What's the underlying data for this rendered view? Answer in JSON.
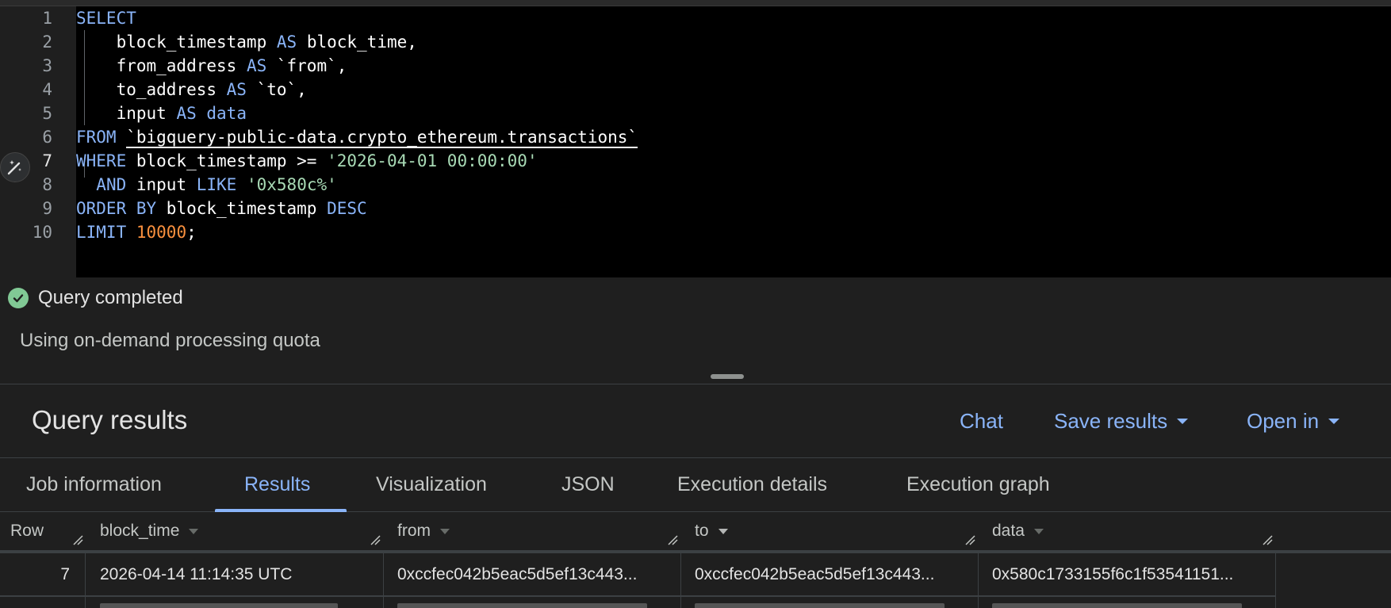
{
  "editor": {
    "lines": [
      {
        "num": "1",
        "tokens": [
          {
            "t": "SELECT",
            "c": "kw"
          }
        ]
      },
      {
        "num": "2",
        "tokens": [
          {
            "t": "    block_timestamp ",
            "c": "id"
          },
          {
            "t": "AS",
            "c": "kw"
          },
          {
            "t": " block_time,",
            "c": "id"
          }
        ]
      },
      {
        "num": "3",
        "tokens": [
          {
            "t": "    from_address ",
            "c": "id"
          },
          {
            "t": "AS",
            "c": "kw"
          },
          {
            "t": " `from`,",
            "c": "id"
          }
        ]
      },
      {
        "num": "4",
        "tokens": [
          {
            "t": "    to_address ",
            "c": "id"
          },
          {
            "t": "AS",
            "c": "kw"
          },
          {
            "t": " `to`,",
            "c": "id"
          }
        ]
      },
      {
        "num": "5",
        "tokens": [
          {
            "t": "    input ",
            "c": "id"
          },
          {
            "t": "AS",
            "c": "kw"
          },
          {
            "t": " ",
            "c": "id"
          },
          {
            "t": "data",
            "c": "kw"
          }
        ]
      },
      {
        "num": "6",
        "tokens": [
          {
            "t": "FROM",
            "c": "kw"
          },
          {
            "t": " ",
            "c": "id"
          },
          {
            "t": "`bigquery-public-data.crypto_ethereum.transactions`",
            "c": "tbl"
          }
        ]
      },
      {
        "num": "7",
        "tokens": [
          {
            "t": "WHERE",
            "c": "kw"
          },
          {
            "t": " block_timestamp >= ",
            "c": "id"
          },
          {
            "t": "'2026-04-01 00:00:00'",
            "c": "str"
          }
        ]
      },
      {
        "num": "8",
        "tokens": [
          {
            "t": "  ",
            "c": "id"
          },
          {
            "t": "AND",
            "c": "kw"
          },
          {
            "t": " input ",
            "c": "id"
          },
          {
            "t": "LIKE",
            "c": "kw"
          },
          {
            "t": " ",
            "c": "id"
          },
          {
            "t": "'0x580c%'",
            "c": "str"
          }
        ]
      },
      {
        "num": "9",
        "tokens": [
          {
            "t": "ORDER BY",
            "c": "kw"
          },
          {
            "t": " block_timestamp ",
            "c": "id"
          },
          {
            "t": "DESC",
            "c": "kw"
          }
        ]
      },
      {
        "num": "10",
        "tokens": [
          {
            "t": "LIMIT",
            "c": "kw"
          },
          {
            "t": " ",
            "c": "id"
          },
          {
            "t": "10000",
            "c": "num"
          },
          {
            "t": ";",
            "c": "id"
          }
        ]
      }
    ],
    "active_line": "7"
  },
  "status": {
    "title": "Query completed",
    "subtitle": "Using on-demand processing quota"
  },
  "results": {
    "title": "Query results",
    "chat_label": "Chat",
    "save_label": "Save results",
    "open_label": "Open in"
  },
  "tabs": [
    {
      "label": "Job information",
      "active": false
    },
    {
      "label": "Results",
      "active": true
    },
    {
      "label": "Visualization",
      "active": false
    },
    {
      "label": "JSON",
      "active": false
    },
    {
      "label": "Execution details",
      "active": false
    },
    {
      "label": "Execution graph",
      "active": false
    }
  ],
  "table": {
    "columns": [
      "Row",
      "block_time",
      "from",
      "to",
      "data"
    ],
    "rows": [
      [
        "7",
        "2026-04-14 11:14:35 UTC",
        "0xccfec042b5eac5d5ef13c443...",
        "0xccfec042b5eac5d5ef13c443...",
        "0x580c1733155f6c1f53541151..."
      ]
    ]
  },
  "colors": {
    "accent": "#8ab4f8",
    "keyword": "#8ab4f8",
    "string": "#a8dab5",
    "number": "#fa903e",
    "success": "#81c995"
  }
}
